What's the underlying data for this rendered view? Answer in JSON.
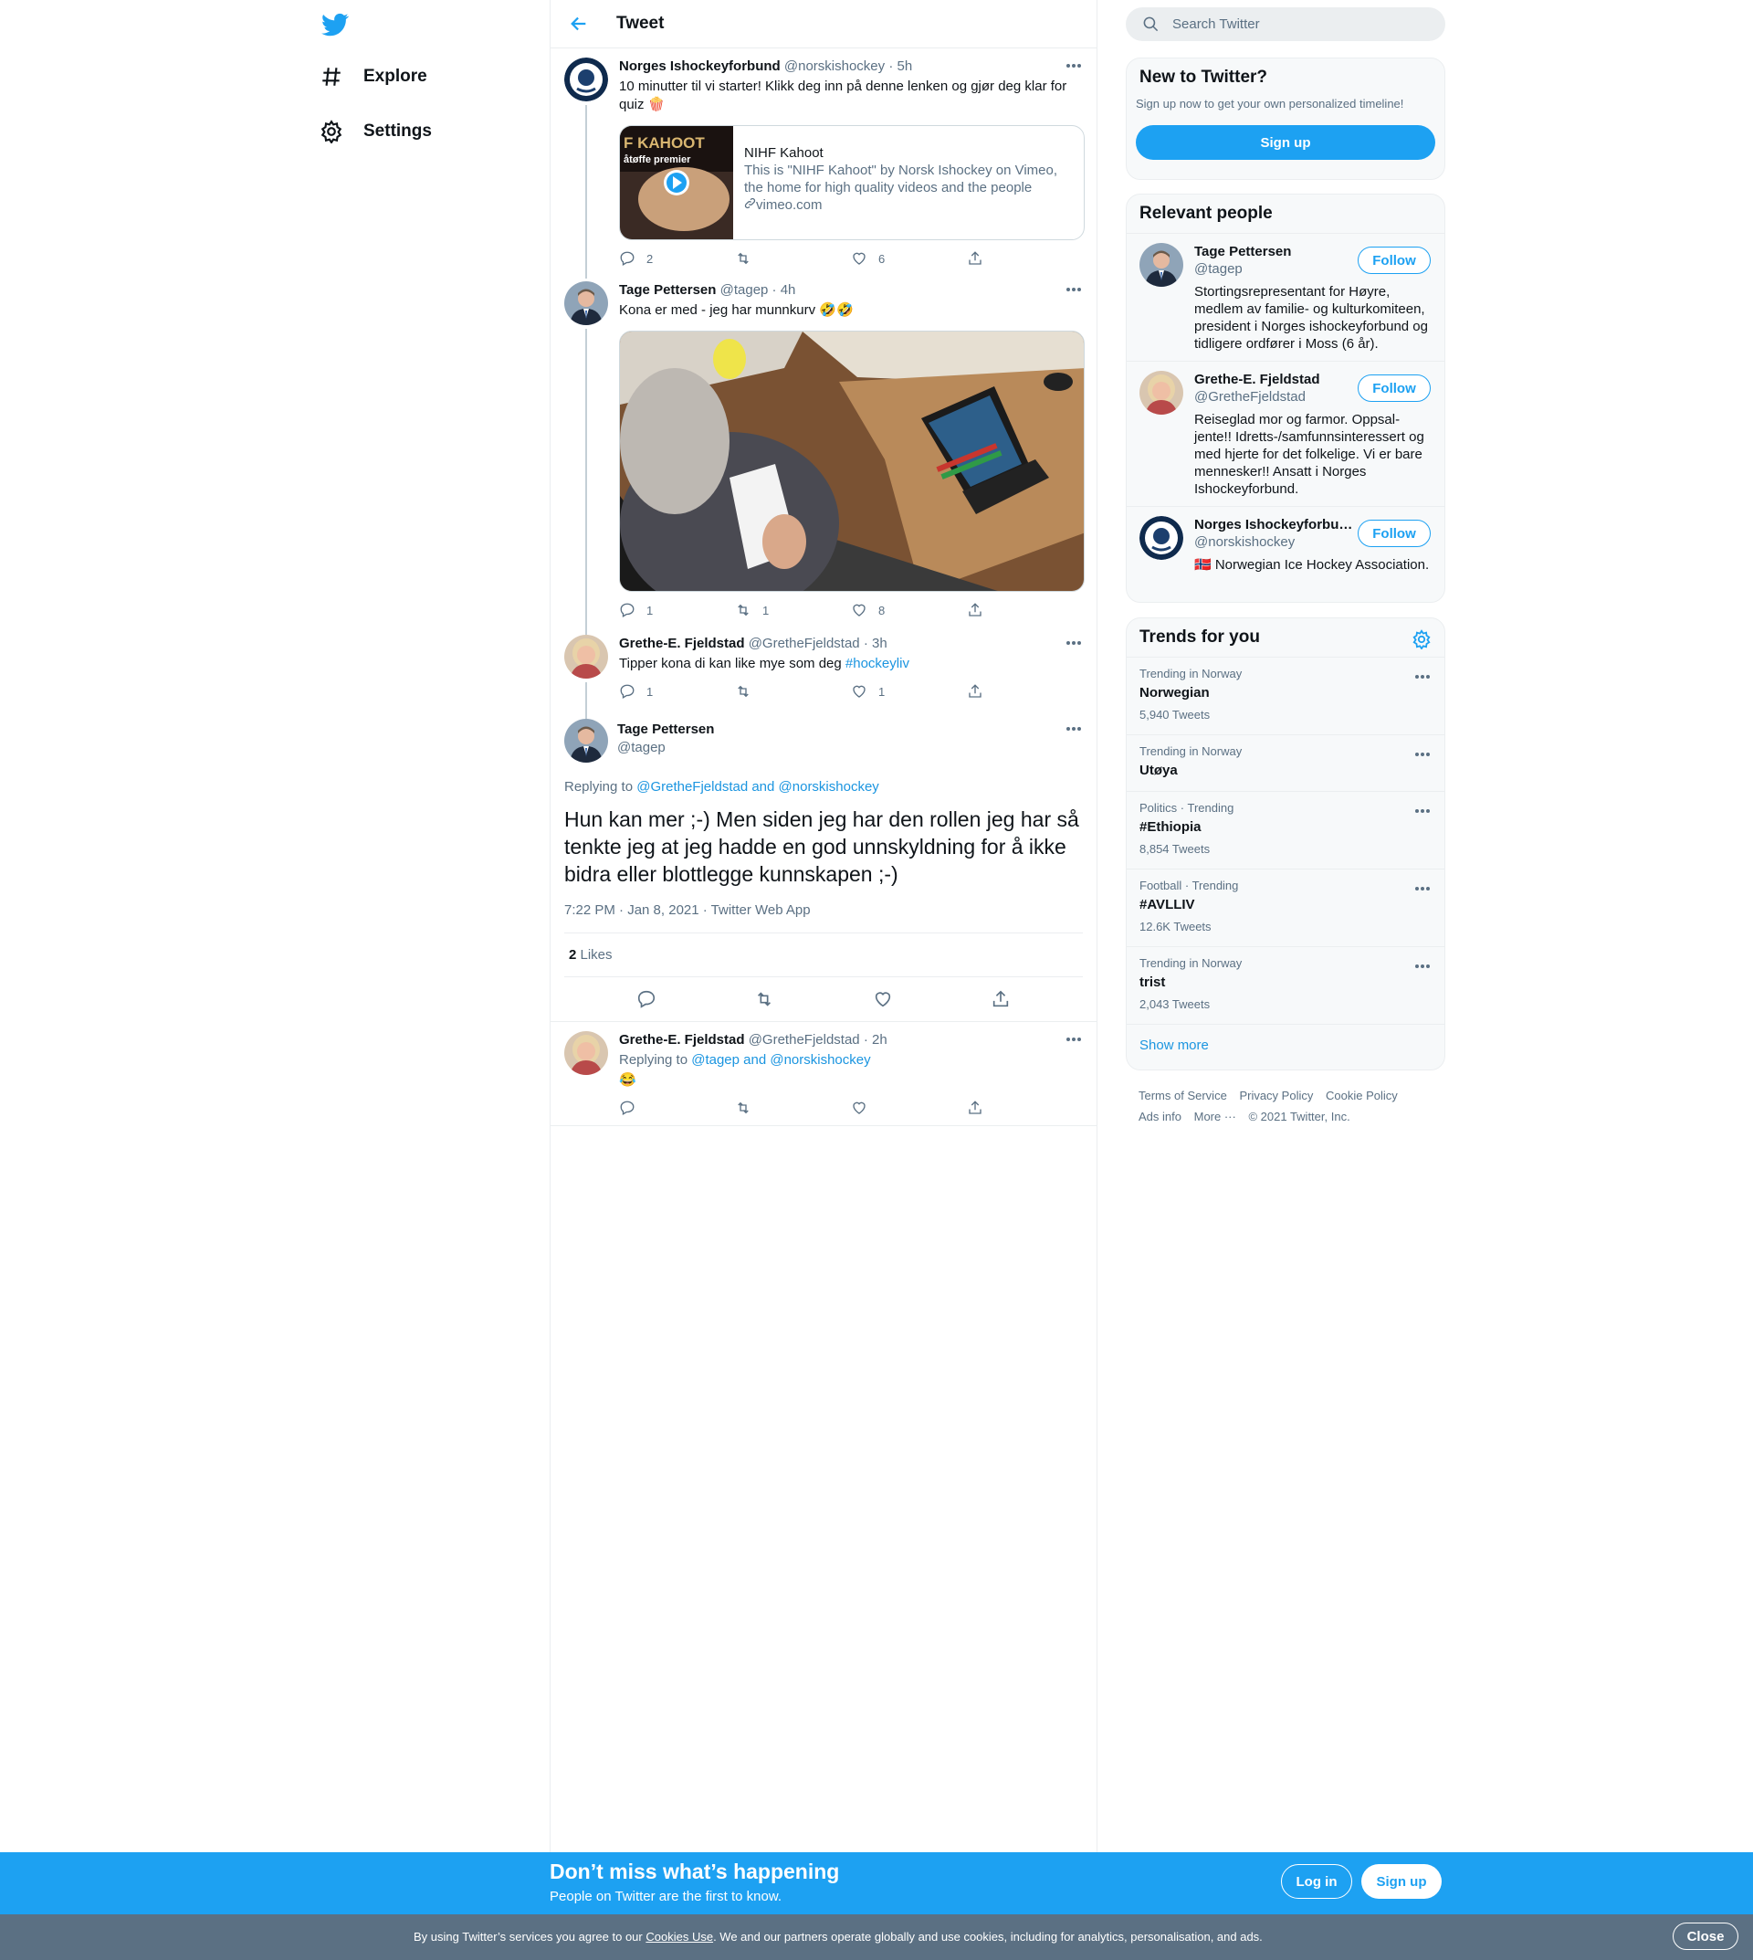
{
  "nav": {
    "items": [
      {
        "label": "Explore",
        "icon": "hashtag-icon"
      },
      {
        "label": "Settings",
        "icon": "gear-icon"
      }
    ]
  },
  "header": {
    "title": "Tweet"
  },
  "thread": [
    {
      "name": "Norges Ishockeyforbund",
      "handle": "@norskishockey",
      "time": "5h",
      "text": "10 minutter til vi starter! Klikk deg inn på denne lenken og gjør deg klar for quiz 🍿",
      "card": {
        "title": "NIHF Kahoot",
        "description": "This is \"NIHF Kahoot\" by Norsk Ishockey on Vimeo, the home for high quality videos and the people who…",
        "link": "vimeo.com",
        "thumb_text": "F KAHOOT",
        "thumb_sub": "åtøffe premier"
      },
      "replies": "2",
      "retweets": "",
      "likes": "6"
    },
    {
      "name": "Tage Pettersen",
      "handle": "@tagep",
      "time": "4h",
      "text": "Kona er med - jeg har munnkurv 🤣🤣",
      "replies": "1",
      "retweets": "1",
      "likes": "8"
    },
    {
      "name": "Grethe-E. Fjeldstad",
      "handle": "@GretheFjeldstad",
      "time": "3h",
      "text": "Tipper kona di kan like mye som deg ",
      "hashtag": "#hockeyliv",
      "replies": "1",
      "retweets": "",
      "likes": "1"
    }
  ],
  "focus": {
    "name": "Tage Pettersen",
    "handle": "@tagep",
    "replying_prefix": "Replying to ",
    "replying_to": "@GretheFjeldstad and @norskishockey",
    "text": "Hun kan mer ;-) Men siden jeg har den rollen jeg har så tenkte jeg at jeg hadde en god unnskyldning for å ikke bidra eller blottlegge kunnskapen ;-)",
    "meta": "7:22 PM · Jan 8, 2021 · Twitter Web App",
    "likes_count": "2",
    "likes_label": " Likes"
  },
  "reply": {
    "name": "Grethe-E. Fjeldstad",
    "handle": "@GretheFjeldstad",
    "time": "2h",
    "replying_prefix": "Replying to ",
    "replying_to": "@tagep and @norskishockey",
    "text": "😂"
  },
  "search": {
    "placeholder": "Search Twitter"
  },
  "signup_panel": {
    "title": "New to Twitter?",
    "subtitle": "Sign up now to get your own personalized timeline!",
    "button": "Sign up"
  },
  "relevant": {
    "title": "Relevant people",
    "follow_label": "Follow",
    "people": [
      {
        "name": "Tage Pettersen",
        "handle": "@tagep",
        "bio": "Stortingsrepresentant for Høyre, medlem av familie- og kulturkomiteen, president i Norges ishockeyforbund og tidligere ordfører i Moss (6 år)."
      },
      {
        "name": "Grethe-E. Fjeldstad",
        "handle": "@GretheFjeldstad",
        "bio": "Reiseglad mor og farmor. Oppsal-jente!! Idretts-/samfunnsinteressert og med hjerte for det folkelige. Vi er bare mennesker!! Ansatt i Norges Ishockeyforbund."
      },
      {
        "name": "Norges Ishockeyforbund",
        "handle": "@norskishockey",
        "bio": "🇳🇴 Norwegian Ice Hockey Association."
      }
    ]
  },
  "trends": {
    "title": "Trends for you",
    "items": [
      {
        "meta": "Trending in Norway",
        "name": "Norwegian",
        "count": "5,940 Tweets"
      },
      {
        "meta": "Trending in Norway",
        "name": "Utøya",
        "count": ""
      },
      {
        "meta": "Politics · Trending",
        "name": "#Ethiopia",
        "count": "8,854 Tweets"
      },
      {
        "meta": "Football · Trending",
        "name": "#AVLLIV",
        "count": "12.6K Tweets"
      },
      {
        "meta": "Trending in Norway",
        "name": "trist",
        "count": "2,043 Tweets"
      }
    ],
    "show_more": "Show more"
  },
  "footer": {
    "links": [
      "Terms of Service",
      "Privacy Policy",
      "Cookie Policy",
      "Ads info",
      "More ···"
    ],
    "copyright": "© 2021 Twitter, Inc."
  },
  "bottom_bar": {
    "title": "Don’t miss what’s happening",
    "subtitle": "People on Twitter are the first to know.",
    "login": "Log in",
    "signup": "Sign up"
  },
  "cookie": {
    "prefix": "By using Twitter’s services you agree to our ",
    "link": "Cookies Use",
    "suffix": ". We and our partners operate globally and use cookies, including for analytics, personalisation, and ads.",
    "close": "Close"
  },
  "colors": {
    "accent": "#1da1f2",
    "link": "#1b95e0",
    "muted": "#5b7083",
    "cookie_bg": "#5b7083"
  }
}
